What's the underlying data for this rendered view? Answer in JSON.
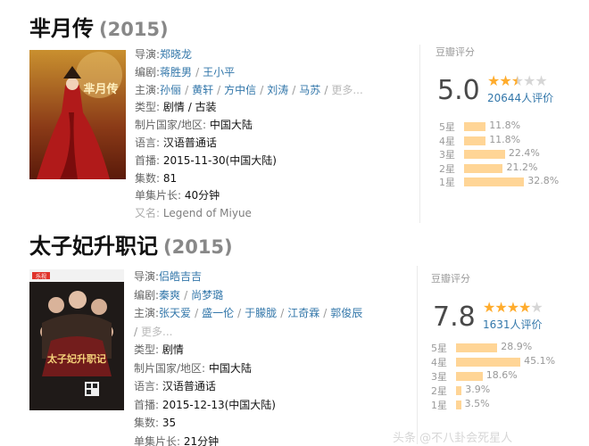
{
  "movies": [
    {
      "title": "芈月传",
      "year": "(2015)",
      "poster": {
        "text": "芈月传"
      },
      "info": {
        "director_label": "导演:",
        "directors": [
          "郑晓龙"
        ],
        "writer_label": "编剧:",
        "writers": [
          "蒋胜男",
          "王小平"
        ],
        "cast_label": "主演:",
        "cast": [
          "孙俪",
          "黄轩",
          "方中信",
          "刘涛",
          "马苏"
        ],
        "more": "更多...",
        "genre_label": "类型:",
        "genre": "剧情 / 古装",
        "country_label": "制片国家/地区:",
        "country": "中国大陆",
        "language_label": "语言:",
        "language": "汉语普通话",
        "premiere_label": "首播:",
        "premiere": "2015-11-30(中国大陆)",
        "episodes_label": "集数:",
        "episodes": "81",
        "runtime_label": "单集片长:",
        "runtime": "40分钟",
        "aka_label": "又名:",
        "aka": "Legend of Miyue"
      },
      "rating": {
        "label": "豆瓣评分",
        "score": "5.0",
        "stars": 2.5,
        "count": "20644人评价",
        "distribution": [
          {
            "label": "5星",
            "percent": 11.8,
            "text": "11.8%"
          },
          {
            "label": "4星",
            "percent": 11.8,
            "text": "11.8%"
          },
          {
            "label": "3星",
            "percent": 22.4,
            "text": "22.4%"
          },
          {
            "label": "2星",
            "percent": 21.2,
            "text": "21.2%"
          },
          {
            "label": "1星",
            "percent": 32.8,
            "text": "32.8%"
          }
        ]
      }
    },
    {
      "title": "太子妃升职记",
      "year": "(2015)",
      "poster": {
        "text": "太子妃升职记",
        "top_text": "乐视"
      },
      "info": {
        "director_label": "导演:",
        "directors": [
          "侣皓吉吉"
        ],
        "writer_label": "编剧:",
        "writers": [
          "秦爽",
          "尚梦璐"
        ],
        "cast_label": "主演:",
        "cast": [
          "张天爱",
          "盛一伦",
          "于朦胧",
          "江奇霖",
          "郭俊辰"
        ],
        "more": "更多...",
        "genre_label": "类型:",
        "genre": "剧情",
        "country_label": "制片国家/地区:",
        "country": "中国大陆",
        "language_label": "语言:",
        "language": "汉语普通话",
        "premiere_label": "首播:",
        "premiere": "2015-12-13(中国大陆)",
        "episodes_label": "集数:",
        "episodes": "35",
        "runtime_label": "单集片长:",
        "runtime": "21分钟"
      },
      "rating": {
        "label": "豆瓣评分",
        "score": "7.8",
        "stars": 4,
        "count": "1631人评价",
        "distribution": [
          {
            "label": "5星",
            "percent": 28.9,
            "text": "28.9%"
          },
          {
            "label": "4星",
            "percent": 45.1,
            "text": "45.1%"
          },
          {
            "label": "3星",
            "percent": 18.6,
            "text": "18.6%"
          },
          {
            "label": "2星",
            "percent": 3.9,
            "text": "3.9%"
          },
          {
            "label": "1星",
            "percent": 3.5,
            "text": "3.5%"
          }
        ]
      }
    }
  ],
  "watermark": "头条 @不八卦会死星人",
  "colors": {
    "link": "#3377aa",
    "star": "#ffac2d",
    "bar": "#ffd596"
  }
}
